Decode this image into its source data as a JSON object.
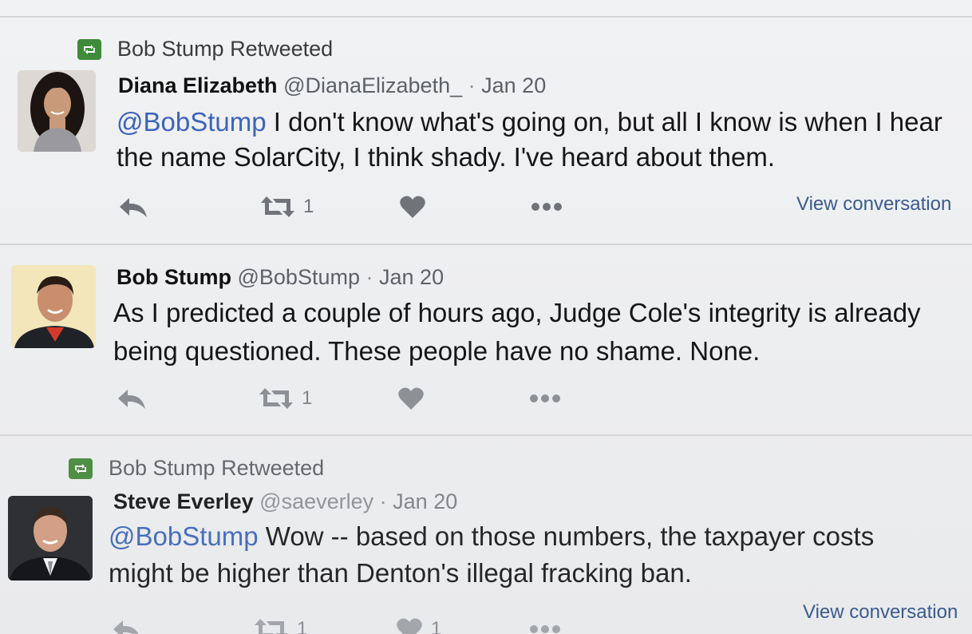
{
  "tweets": [
    {
      "retweeted_by": "Bob Stump Retweeted",
      "name": "Diana Elizabeth",
      "handle": "@DianaElizabeth_",
      "separator": "·",
      "time": "Jan 20",
      "mention": "@BobStump",
      "line1": " I don't know what's going on, but all I know is when I hear",
      "line2": "the name SolarCity, I think shady. I've heard about them.",
      "retweet_count": "1",
      "like_count": "",
      "view_conversation": "View conversation"
    },
    {
      "name": "Bob Stump",
      "handle": "@BobStump",
      "separator": "·",
      "time": "Jan 20",
      "line1": "As I predicted a couple of hours ago, Judge Cole's integrity is already",
      "line2": "being questioned. These people have no shame. None.",
      "retweet_count": "1",
      "like_count": ""
    },
    {
      "retweeted_by": "Bob Stump Retweeted",
      "name": "Steve Everley",
      "handle": "@saeverley",
      "separator": "·",
      "time": "Jan 20",
      "mention": "@BobStump",
      "line1": " Wow -- based on those numbers, the taxpayer costs",
      "line2": "might be higher than Denton's illegal fracking ban.",
      "retweet_count": "1",
      "like_count": "1",
      "view_conversation": "View conversation"
    }
  ],
  "icons": {
    "retweeted": "retweet-icon",
    "reply": "reply-icon",
    "retweet": "retweet-icon",
    "like": "heart-icon",
    "more": "more-icon"
  },
  "colors": {
    "retweet_badge": "#3f8a3b",
    "mention": "#3b64b8",
    "link": "#3b5b8e"
  }
}
